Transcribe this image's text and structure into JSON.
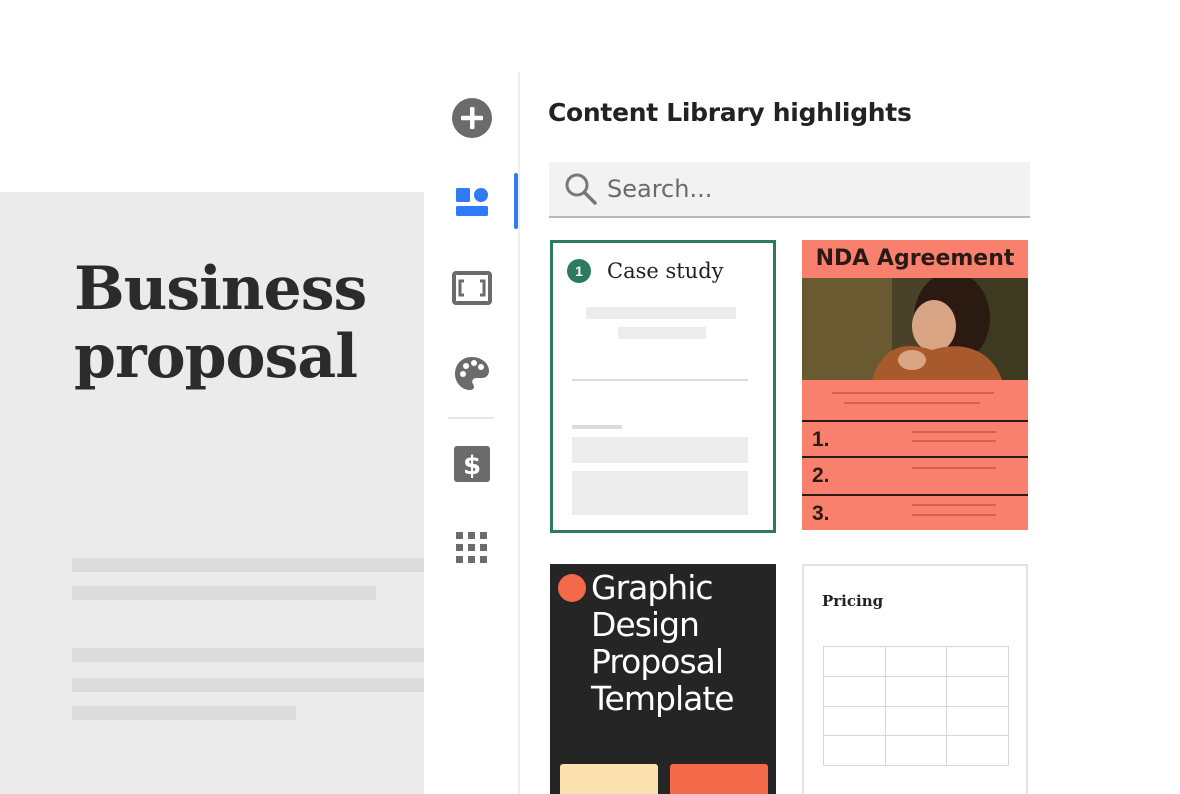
{
  "document": {
    "title_line1": "Business",
    "title_line2": "proposal"
  },
  "rail": {
    "items": [
      {
        "icon": "add-icon",
        "active": false
      },
      {
        "icon": "content-blocks-icon",
        "active": true
      },
      {
        "icon": "media-frame-icon",
        "active": false
      },
      {
        "icon": "palette-icon",
        "active": false
      },
      {
        "icon": "dollar-icon",
        "active": false
      },
      {
        "icon": "apps-grid-icon",
        "active": false
      }
    ],
    "accent_color": "#2f7bf6"
  },
  "panel": {
    "title": "Content Library highlights"
  },
  "search": {
    "placeholder": "Search..."
  },
  "cards": {
    "case_study": {
      "badge": "1",
      "title": "Case study",
      "border_color": "#2c7a60"
    },
    "nda": {
      "title": "NDA Agreement",
      "items": [
        "1.",
        "2.",
        "3."
      ],
      "background": "#fa806e"
    },
    "graphic_design": {
      "title": "Graphic Design Proposal Template",
      "accent": "#f5694b"
    },
    "pricing": {
      "title": "Pricing"
    }
  }
}
